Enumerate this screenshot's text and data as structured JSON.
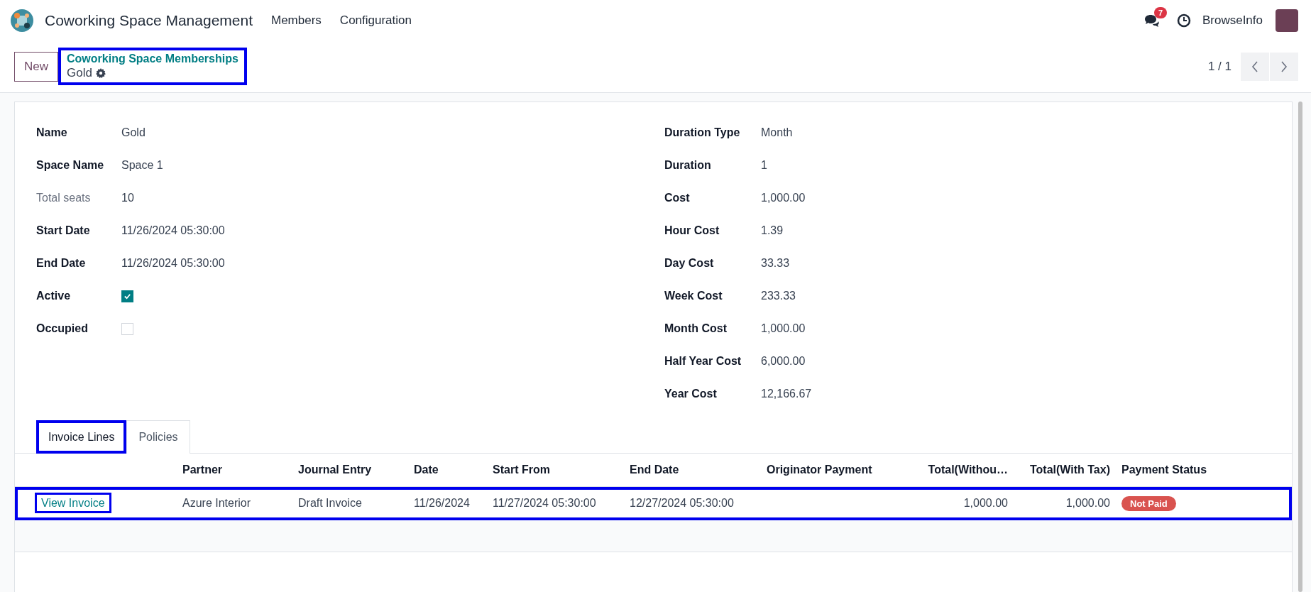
{
  "navbar": {
    "app_title": "Coworking Space Management",
    "menus": [
      "Members",
      "Configuration"
    ],
    "messages_badge": "7",
    "user_name": "BrowseInfo"
  },
  "control_panel": {
    "new_button": "New",
    "breadcrumb": {
      "parent": "Coworking Space Memberships",
      "current": "Gold",
      "highlighted": true
    },
    "pager": "1 / 1"
  },
  "left_fields": [
    {
      "label": "Name",
      "kind": "text",
      "value": "Gold",
      "muted": false
    },
    {
      "label": "Space Name",
      "kind": "text",
      "value": "Space 1",
      "muted": false
    },
    {
      "label": "Total seats",
      "kind": "text",
      "value": "10",
      "muted": true
    },
    {
      "label": "Start Date",
      "kind": "text",
      "value": "11/26/2024 05:30:00",
      "muted": false
    },
    {
      "label": "End Date",
      "kind": "text",
      "value": "11/26/2024 05:30:00",
      "muted": false
    },
    {
      "label": "Active",
      "kind": "checkbox",
      "checked": true,
      "muted": false
    },
    {
      "label": "Occupied",
      "kind": "checkbox",
      "checked": false,
      "muted": false
    }
  ],
  "right_fields": [
    {
      "label": "Duration Type",
      "value": "Month"
    },
    {
      "label": "Duration",
      "value": "1"
    },
    {
      "label": "Cost",
      "value": "1,000.00"
    },
    {
      "label": "Hour Cost",
      "value": "1.39"
    },
    {
      "label": "Day Cost",
      "value": "33.33"
    },
    {
      "label": "Week Cost",
      "value": "233.33"
    },
    {
      "label": "Month Cost",
      "value": "1,000.00"
    },
    {
      "label": "Half Year Cost",
      "value": "6,000.00"
    },
    {
      "label": "Year Cost",
      "value": "12,166.67"
    }
  ],
  "tabs": [
    {
      "label": "Invoice Lines",
      "selected": true,
      "highlighted": true
    },
    {
      "label": "Policies",
      "selected": false,
      "highlighted": false
    }
  ],
  "table": {
    "columns": [
      "",
      "Partner",
      "Journal Entry",
      "Date",
      "Start From",
      "End Date",
      "Originator Payment",
      "Total(Withou…",
      "Total(With Tax)",
      "Payment Status"
    ],
    "rows": [
      {
        "link": "View Invoice",
        "link_highlighted": true,
        "highlighted": true,
        "partner": "Azure Interior",
        "journal_entry": "Draft Invoice",
        "date": "11/26/2024",
        "start_from": "11/27/2024 05:30:00",
        "end_date": "12/27/2024 05:30:00",
        "total_without_tax": "1,000.00",
        "total_with_tax": "1,000.00",
        "payment_status": "Not Paid"
      }
    ]
  }
}
